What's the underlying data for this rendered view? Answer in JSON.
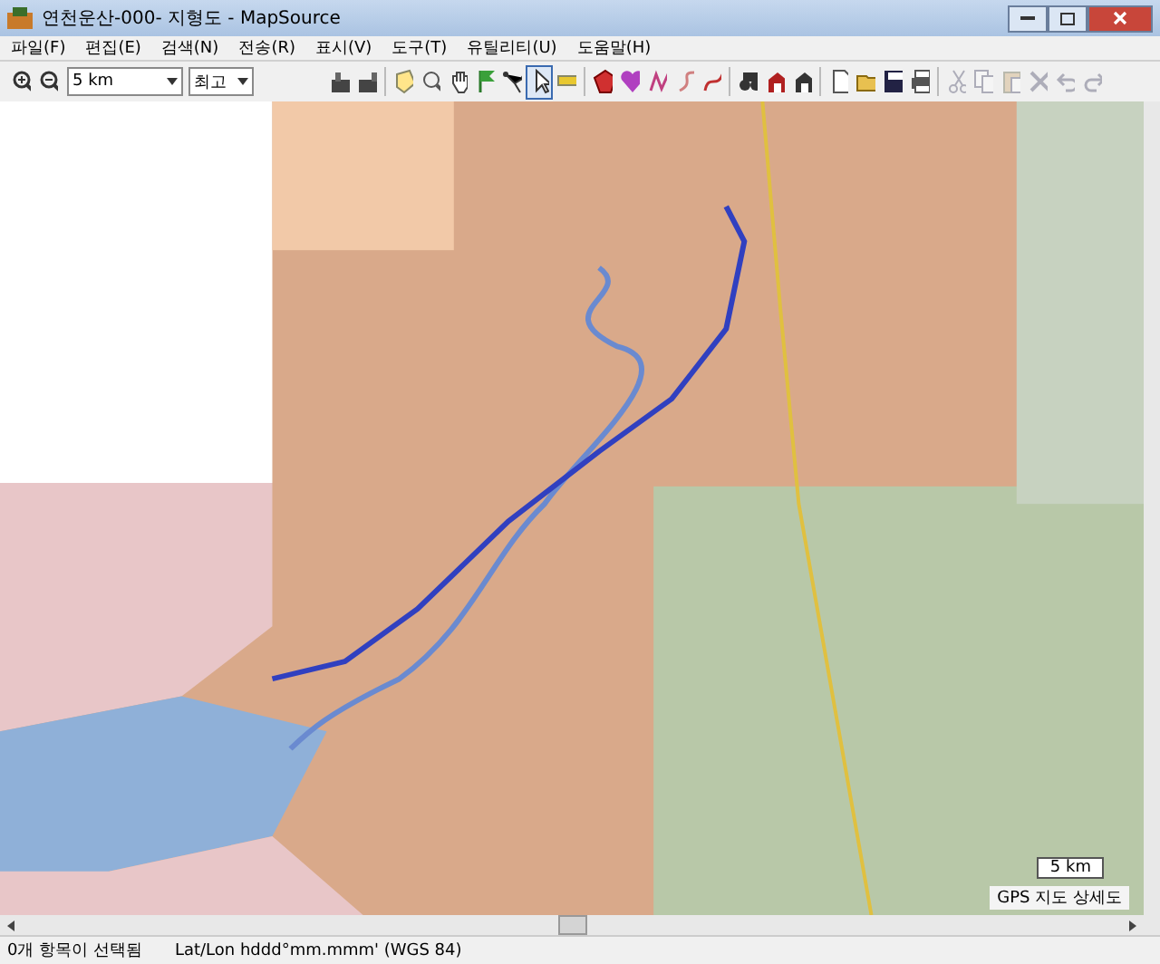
{
  "window": {
    "title": "연천운산-000- 지형도 - MapSource"
  },
  "menu": [
    "파일(F)",
    "편집(E)",
    "검색(N)",
    "전송(R)",
    "표시(V)",
    "도구(T)",
    "유틸리티(U)",
    "도움말(H)"
  ],
  "toolbar": {
    "zoom_level": "5 km",
    "detail": "최고",
    "map_tools": [
      {
        "selected": false
      },
      {
        "selected": false
      },
      {
        "selected": false
      },
      {
        "selected": false
      },
      {
        "selected": false
      },
      {
        "selected": true
      },
      {
        "selected": false
      }
    ],
    "edit_buttons": [
      {
        "disabled": true
      },
      {
        "disabled": true
      },
      {
        "disabled": true
      },
      {
        "disabled": true
      },
      {
        "disabled": true
      },
      {
        "disabled": true
      }
    ]
  },
  "map": {
    "scale": "5 km",
    "map_type": "GPS 지도 상세도"
  },
  "status_bar": {
    "selection": "0개 항목이 선택됨",
    "position_format": "Lat/Lon hddd°mm.mmm' (WGS 84)"
  }
}
